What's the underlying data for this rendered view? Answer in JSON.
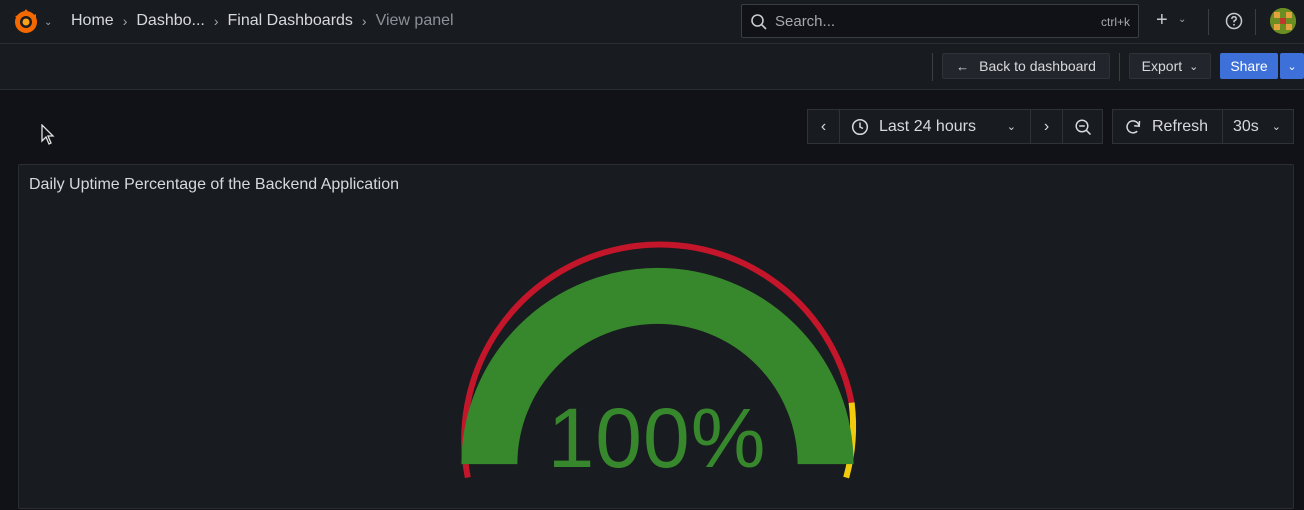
{
  "breadcrumbs": [
    "Home",
    "Dashbo...",
    "Final Dashboards",
    "View panel"
  ],
  "search": {
    "placeholder": "Search...",
    "shortcut": "ctrl+k"
  },
  "toolbar": {
    "back_label": "Back to dashboard",
    "export_label": "Export",
    "share_label": "Share"
  },
  "time_controls": {
    "range_label": "Last 24 hours",
    "refresh_label": "Refresh",
    "interval_label": "30s"
  },
  "panel": {
    "title": "Daily Uptime Percentage of the Backend Application",
    "value_text": "100%"
  },
  "colors": {
    "accent": "#3d71d9",
    "gauge_fill": "#37872d",
    "threshold_red": "#c4162a",
    "threshold_yellow": "#f2cc0c",
    "logo_orange": "#f46800"
  },
  "icons": [
    "grafana-logo-icon",
    "search-icon",
    "plus-icon",
    "help-icon",
    "avatar",
    "arrow-left-icon",
    "chevron-down-icon",
    "chevron-left-icon",
    "chevron-right-icon",
    "clock-icon",
    "zoom-out-icon",
    "refresh-icon"
  ]
}
